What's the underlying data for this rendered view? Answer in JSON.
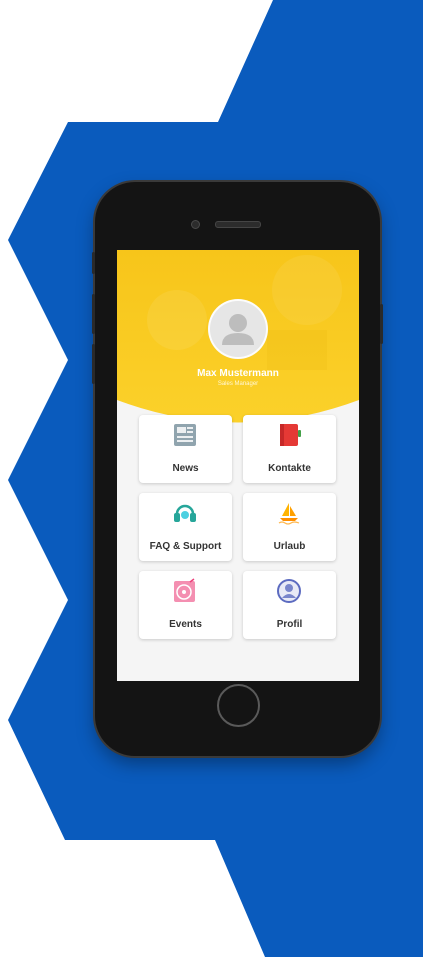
{
  "user": {
    "name": "Max Mustermann",
    "role": "Sales Manager"
  },
  "menu": {
    "tiles": [
      {
        "label": "News",
        "icon": "news-icon"
      },
      {
        "label": "Kontakte",
        "icon": "contacts-book-icon"
      },
      {
        "label": "FAQ & Support",
        "icon": "headset-icon"
      },
      {
        "label": "Urlaub",
        "icon": "sailboat-icon"
      },
      {
        "label": "Events",
        "icon": "vinyl-record-icon"
      },
      {
        "label": "Profil",
        "icon": "user-profile-icon"
      }
    ]
  },
  "colors": {
    "background_blue": "#0a5bbd",
    "header_yellow": "#f9cc1c",
    "phone_body": "#141414"
  }
}
